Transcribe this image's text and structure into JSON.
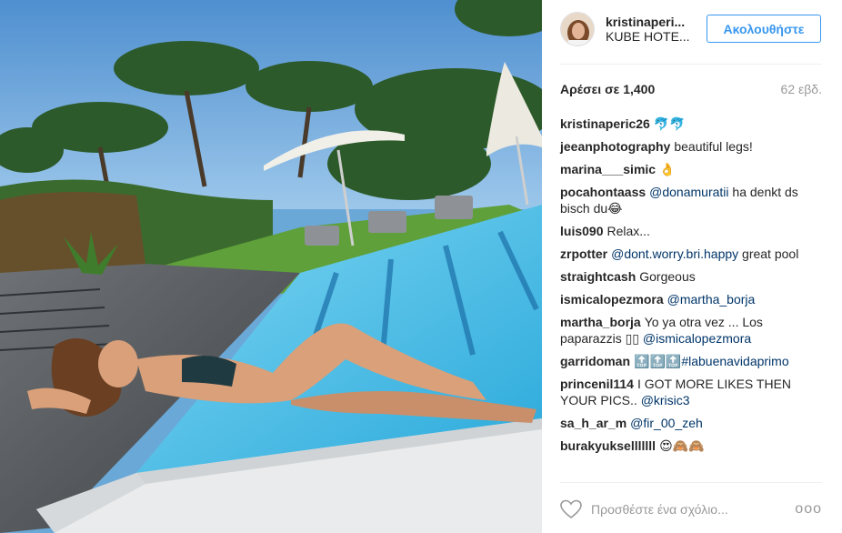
{
  "post": {
    "username": "kristinaperi...",
    "location": "KUBE HOTE...",
    "follow_label": "Ακολουθήστε",
    "likes": "Αρέσει σε 1,400",
    "age": "62 εβδ.",
    "add_comment_placeholder": "Προσθέστε ένα σχόλιο...",
    "more_label": "ooo"
  },
  "comments": [
    {
      "user": "kristinaperic26",
      "text": "🐬🐬"
    },
    {
      "user": "jeeanphotography",
      "text": "beautiful legs!"
    },
    {
      "user": "marina___simic",
      "text": "👌"
    },
    {
      "user": "pocahontaass",
      "mention": "@donamuratii",
      "text": "ha denkt ds bisch du😂"
    },
    {
      "user": "luis090",
      "text": "Relax..."
    },
    {
      "user": "zrpotter",
      "mention": "@dont.worry.bri.happy",
      "text": "great pool"
    },
    {
      "user": "straightcash",
      "text": "Gorgeous"
    },
    {
      "user": "ismicalopezmora",
      "mention": "@martha_borja",
      "text": ""
    },
    {
      "user": "martha_borja",
      "text": "Yo ya otra vez ... Los paparazzis ▯▯",
      "mention_after": "@ismicalopezmora"
    },
    {
      "user": "garridoman",
      "text": "🔝🔝🔝",
      "mention_after": "#labuenavidaprimo"
    },
    {
      "user": "princenil114",
      "text": "I GOT MORE LIKES THEN YOUR PICS..",
      "mention_after": "@krisic3"
    },
    {
      "user": "sa_h_ar_m",
      "mention": "@fir_00_zeh",
      "text": ""
    },
    {
      "user": "burakyukselllllll",
      "text": "😍🙈🙈"
    }
  ],
  "colors": {
    "accent": "#3897f0",
    "mention": "#003569",
    "muted": "#999999",
    "text": "#262626"
  }
}
